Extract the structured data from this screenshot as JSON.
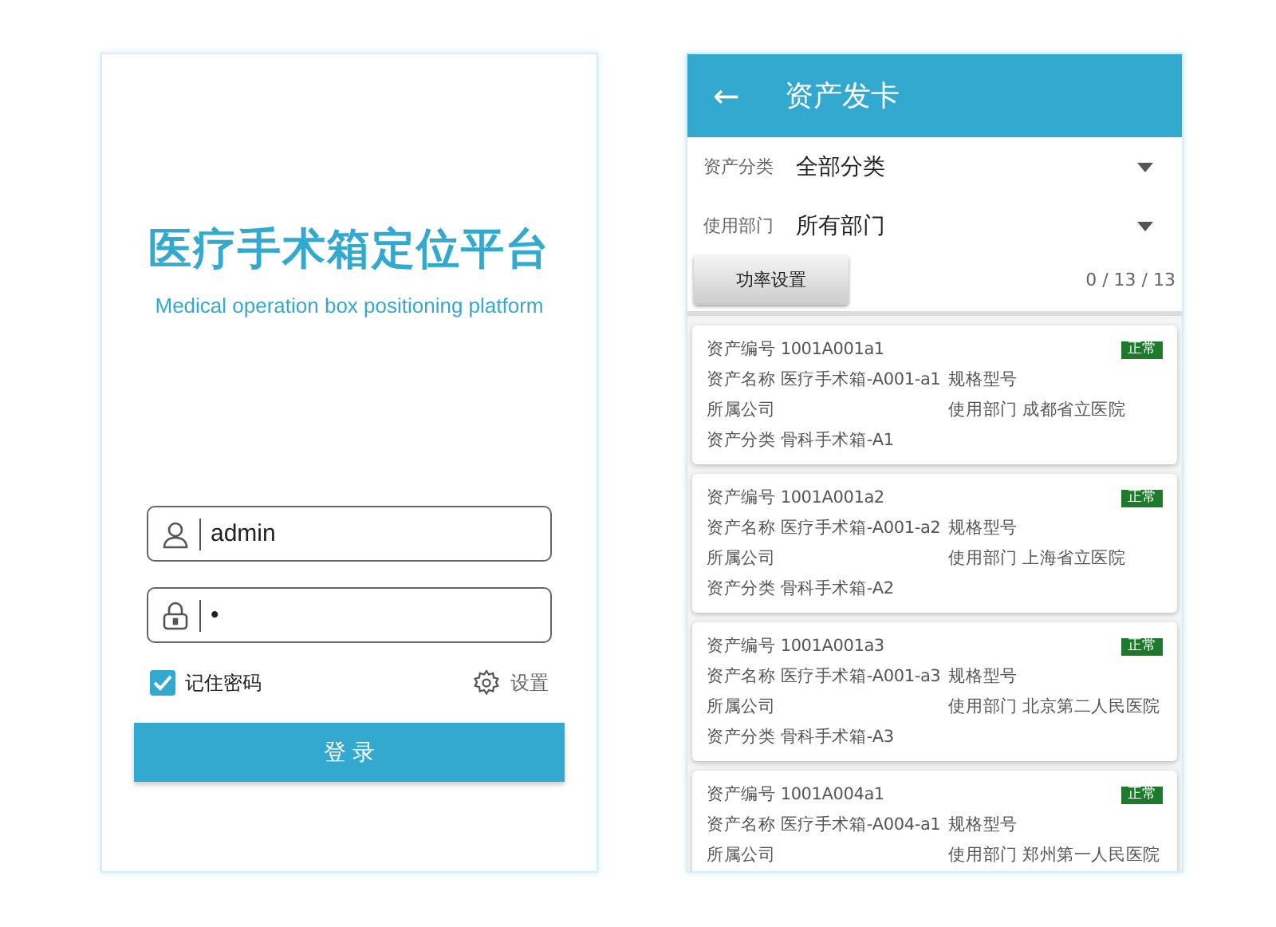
{
  "login": {
    "title": "医疗手术箱定位平台",
    "subtitle": "Medical operation box positioning platform",
    "username": {
      "value": "admin"
    },
    "password": {
      "value": "•"
    },
    "remember": {
      "label": "记住密码",
      "checked": true
    },
    "settings": {
      "label": "设置"
    },
    "submit": "登 录"
  },
  "assets": {
    "back": "←",
    "title": "资产发卡",
    "filters": [
      {
        "label": "资产分类",
        "value": "全部分类"
      },
      {
        "label": "使用部门",
        "value": "所有部门"
      }
    ],
    "power_button": "功率设置",
    "count": "0 / 13 / 13",
    "cards": [
      {
        "code": {
          "label": "资产编号",
          "value": "1001A001a1"
        },
        "status": "正常",
        "fields": [
          {
            "label": "资产名称",
            "value": "医疗手术箱-A001-a1"
          },
          {
            "label": "规格型号"
          },
          {
            "label": "所属公司"
          },
          {
            "label": "使用部门",
            "value": "成都省立医院"
          },
          {
            "label": "资产分类",
            "value": "骨科手术箱-A1"
          }
        ]
      },
      {
        "code": {
          "label": "资产编号",
          "value": "1001A001a2"
        },
        "status": "正常",
        "fields": [
          {
            "label": "资产名称",
            "value": "医疗手术箱-A001-a2"
          },
          {
            "label": "规格型号"
          },
          {
            "label": "所属公司"
          },
          {
            "label": "使用部门",
            "value": "上海省立医院"
          },
          {
            "label": "资产分类",
            "value": "骨科手术箱-A2"
          }
        ]
      },
      {
        "code": {
          "label": "资产编号",
          "value": "1001A001a3"
        },
        "status": "正常",
        "fields": [
          {
            "label": "资产名称",
            "value": "医疗手术箱-A001-a3"
          },
          {
            "label": "规格型号"
          },
          {
            "label": "所属公司"
          },
          {
            "label": "使用部门",
            "value": "北京第二人民医院"
          },
          {
            "label": "资产分类",
            "value": "骨科手术箱-A3"
          }
        ]
      },
      {
        "code": {
          "label": "资产编号",
          "value": "1001A004a1"
        },
        "status": "正常",
        "fields": [
          {
            "label": "资产名称",
            "value": "医疗手术箱-A004-a1"
          },
          {
            "label": "规格型号"
          },
          {
            "label": "所属公司"
          },
          {
            "label": "使用部门",
            "value": "郑州第一人民医院"
          }
        ]
      }
    ]
  }
}
